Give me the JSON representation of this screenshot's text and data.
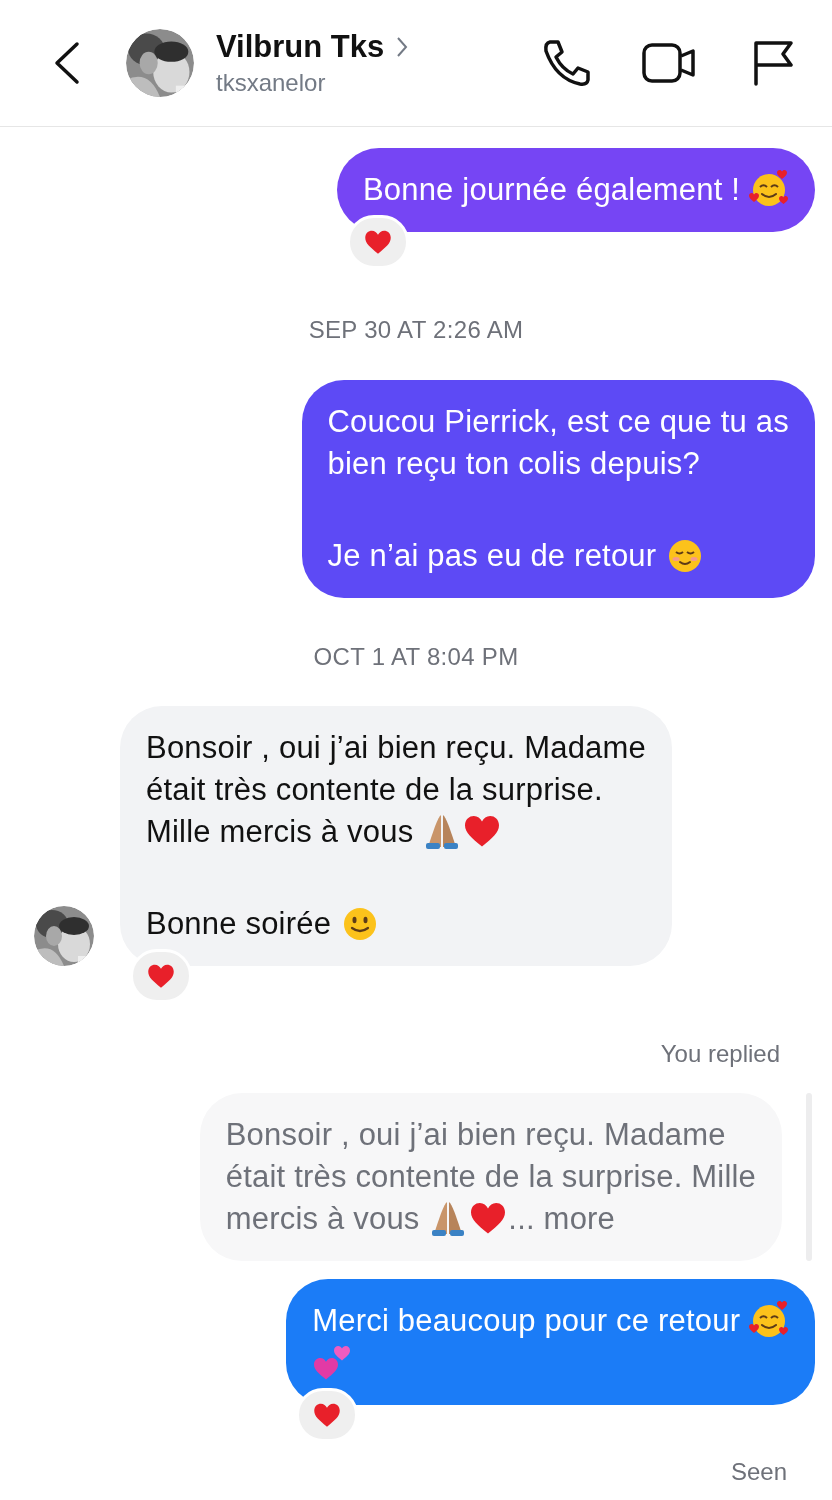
{
  "header": {
    "name": "Vilbrun Tks",
    "username": "tksxanelor"
  },
  "thread": [
    {
      "kind": "sent",
      "color": "#7645f4",
      "paragraphs": [
        [
          [
            {
              "kind": "text",
              "text": "Bonne journée également ! "
            },
            {
              "kind": "hearts-face"
            }
          ]
        ]
      ],
      "reacted": true
    },
    {
      "kind": "timestamp",
      "text": "SEP 30 AT 2:26 AM"
    },
    {
      "kind": "sent",
      "color": "#5d4af5",
      "paragraphs": [
        [
          [
            {
              "kind": "text",
              "text": "Coucou Pierrick, est ce que tu as"
            }
          ],
          [
            {
              "kind": "text",
              "text": "bien reçu ton colis depuis?"
            }
          ]
        ],
        [
          [
            {
              "kind": "text",
              "text": "Je n’ai pas eu de retour "
            },
            {
              "kind": "blush"
            }
          ]
        ]
      ],
      "reacted": false
    },
    {
      "kind": "timestamp",
      "text": "OCT 1 AT 8:04 PM"
    },
    {
      "kind": "received",
      "color": "#f2f3f5",
      "paragraphs": [
        [
          [
            {
              "kind": "text",
              "text": "Bonsoir , oui j’ai bien reçu. Madame"
            }
          ],
          [
            {
              "kind": "text",
              "text": "était très contente de la surprise."
            }
          ],
          [
            {
              "kind": "text",
              "text": "Mille mercis à vous "
            },
            {
              "kind": "pray"
            },
            {
              "kind": "heart"
            }
          ]
        ],
        [
          [
            {
              "kind": "text",
              "text": "Bonne soirée "
            },
            {
              "kind": "smile"
            }
          ]
        ]
      ],
      "reacted": true
    },
    {
      "kind": "label",
      "text": "You replied"
    },
    {
      "kind": "quote",
      "paragraphs": [
        [
          [
            {
              "kind": "text",
              "text": "Bonsoir , oui j’ai bien reçu. Madame"
            }
          ],
          [
            {
              "kind": "text",
              "text": "était très contente de la surprise. Mille"
            }
          ],
          [
            {
              "kind": "text",
              "text": "mercis à vous "
            },
            {
              "kind": "pray"
            },
            {
              "kind": "heart"
            },
            {
              "kind": "text",
              "text": "... more"
            }
          ]
        ]
      ]
    },
    {
      "kind": "sent",
      "color": "#1b7cf7",
      "paragraphs": [
        [
          [
            {
              "kind": "text",
              "text": "Merci beaucoup pour ce retour "
            },
            {
              "kind": "hearts-face"
            }
          ],
          [
            {
              "kind": "two-hearts"
            }
          ]
        ]
      ],
      "reacted": true
    },
    {
      "kind": "status",
      "text": "Seen"
    }
  ]
}
